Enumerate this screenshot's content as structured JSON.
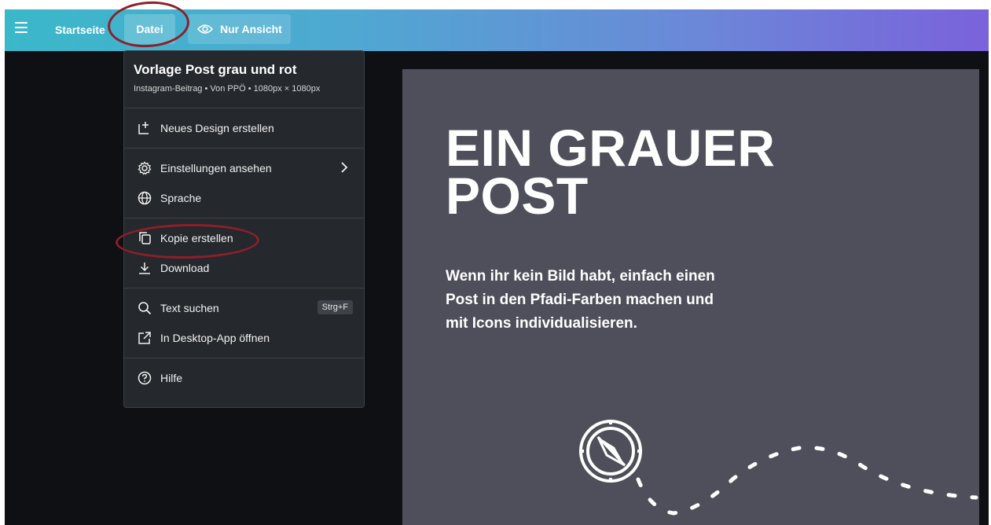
{
  "topbar": {
    "home_label": "Startseite",
    "file_label": "Datei",
    "view_label": "Nur Ansicht",
    "view_icon": "eye-icon"
  },
  "file_menu": {
    "title": "Vorlage Post grau und rot",
    "subtitle": "Instagram-Beitrag • Von PPÖ • 1080px × 1080px",
    "items": [
      {
        "label": "Neues Design erstellen",
        "icon": "add-design-icon"
      },
      {
        "label": "Einstellungen ansehen",
        "icon": "gear-icon"
      },
      {
        "label": "Sprache",
        "icon": "globe-icon"
      },
      {
        "label": "Kopie erstellen",
        "icon": "copy-icon"
      },
      {
        "label": "Download",
        "icon": "download-icon"
      },
      {
        "label": "Text suchen",
        "icon": "search-icon",
        "shortcut": "Strg+F"
      },
      {
        "label": "In Desktop-App öffnen",
        "icon": "external-link-icon"
      },
      {
        "label": "Hilfe",
        "icon": "help-icon"
      }
    ]
  },
  "design": {
    "headline_line1": "EIN GRAUER",
    "headline_line2": "POST",
    "body_line1": "Wenn ihr kein Bild habt, einfach einen",
    "body_line2": "Post in den Pfadi-Farben machen und",
    "body_line3": "mit Icons individualisieren.",
    "background_color": "#4f4f5b",
    "icon": "compass-icon"
  },
  "colors": {
    "annotation": "#8e1f2a",
    "menu_bg": "#25282d",
    "workspace_bg": "#0e1014"
  }
}
